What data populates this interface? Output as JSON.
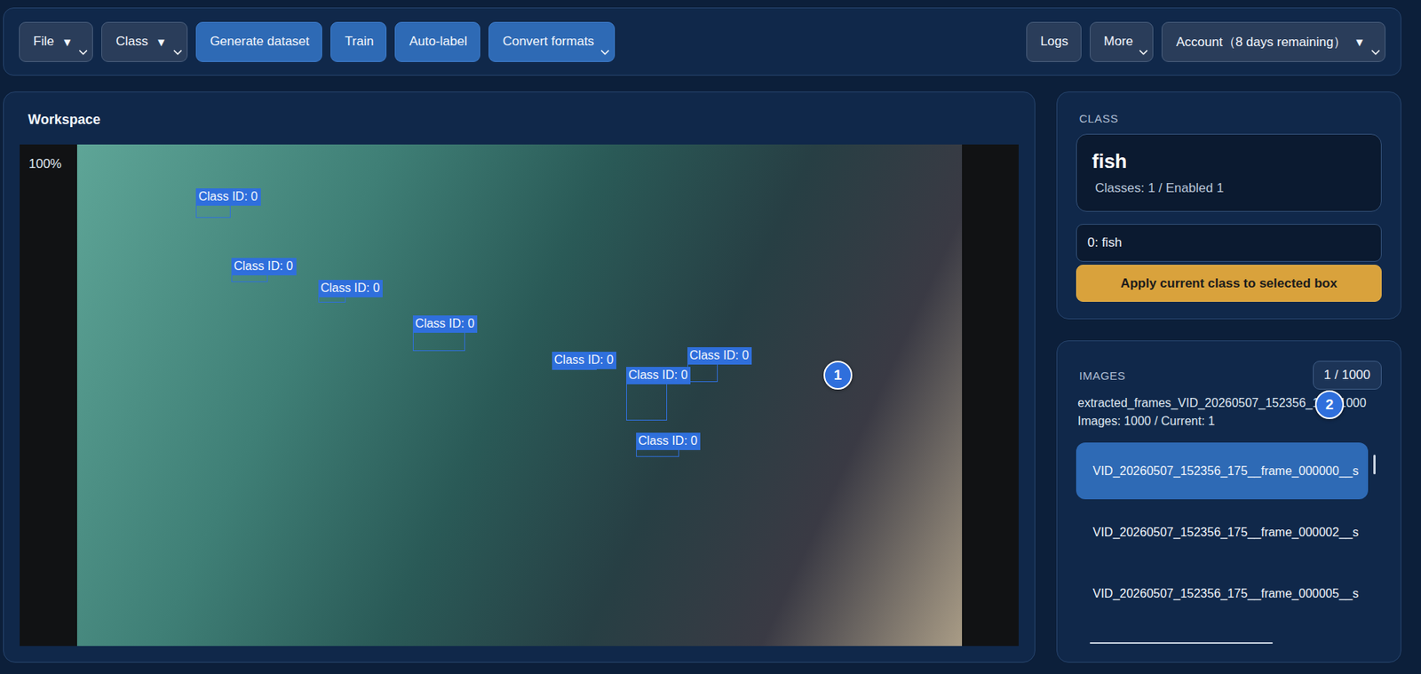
{
  "toolbar": {
    "left": [
      {
        "label": "File",
        "caret": "▼",
        "dropdown": true,
        "kind": "secondary"
      },
      {
        "label": "Class",
        "caret": "▼",
        "dropdown": true,
        "kind": "secondary"
      },
      {
        "label": "Generate dataset",
        "dropdown": false,
        "kind": "primary"
      },
      {
        "label": "Train",
        "dropdown": false,
        "kind": "primary"
      },
      {
        "label": "Auto-label",
        "dropdown": false,
        "kind": "primary"
      },
      {
        "label": "Convert formats",
        "dropdown": true,
        "kind": "primary"
      }
    ],
    "right": [
      {
        "label": "Logs",
        "dropdown": false,
        "kind": "secondary"
      },
      {
        "label": "More",
        "dropdown": true,
        "kind": "secondary"
      },
      {
        "label": "Account（8 days remaining）",
        "caret": "▼",
        "dropdown": true,
        "kind": "secondary"
      }
    ]
  },
  "workspace": {
    "title": "Workspace",
    "zoom": "100%",
    "boxes": [
      {
        "label": "Class ID: 0"
      },
      {
        "label": "Class ID: 0"
      },
      {
        "label": "Class ID: 0"
      },
      {
        "label": "Class ID: 0"
      },
      {
        "label": "Class ID: 0"
      },
      {
        "label": "Class ID: 0"
      },
      {
        "label": "Class ID: 0"
      },
      {
        "label": "Class ID: 0"
      }
    ]
  },
  "class_panel": {
    "heading": "CLASS",
    "name": "fish",
    "summary": "Classes: 1 / Enabled 1",
    "select": "0: fish",
    "apply_button": "Apply current class to selected box"
  },
  "images_panel": {
    "heading": "IMAGES",
    "counter": "1 / 1000",
    "folder": "extracted_frames_VID_20260507_152356_175_1000",
    "summary": "Images: 1000 / Current: 1",
    "items": [
      {
        "label": "VID_20260507_152356_175__frame_000000__s",
        "selected": true
      },
      {
        "label": "VID_20260507_152356_175__frame_000002__s",
        "selected": false
      },
      {
        "label": "VID_20260507_152356_175__frame_000005__s",
        "selected": false
      }
    ]
  },
  "markers": [
    {
      "label": "1"
    },
    {
      "label": "2"
    }
  ]
}
